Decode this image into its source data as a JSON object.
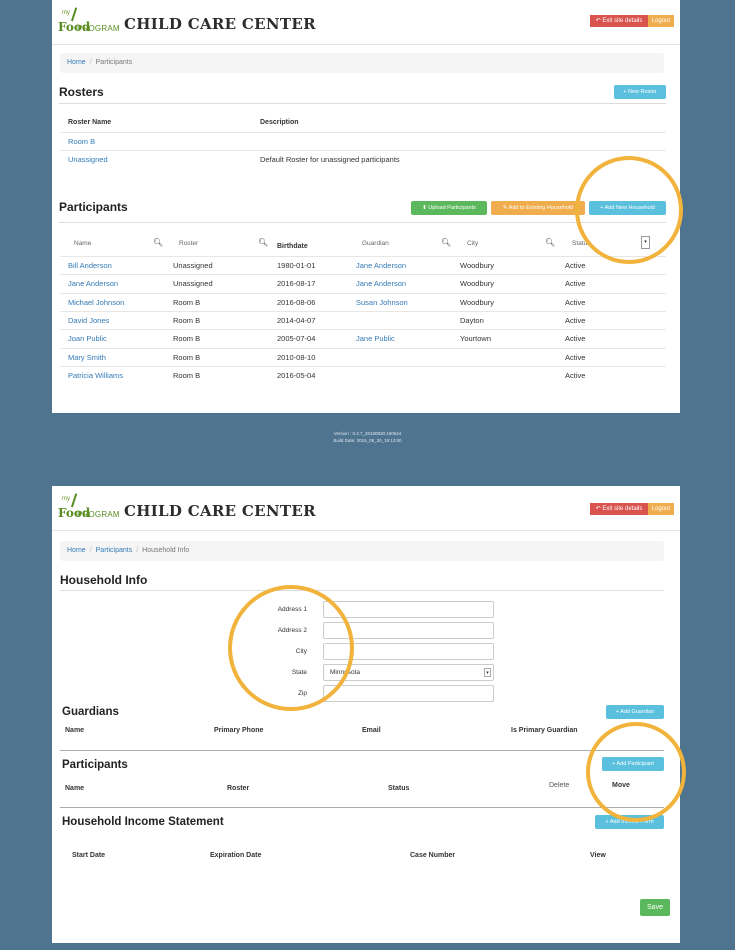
{
  "app": {
    "logo_my": "my",
    "logo_food": "Food",
    "logo_program": "PROGRAM",
    "title": "CHILD CARE CENTER",
    "exit_label": "Exit site details",
    "logout_label": "Logout"
  },
  "screen1": {
    "breadcrumb": [
      "Home",
      "Participants"
    ],
    "rosters": {
      "title": "Rosters",
      "new_button": "+ New Roster",
      "columns": [
        "Roster Name",
        "Description"
      ],
      "rows": [
        {
          "name": "Room B",
          "description": ""
        },
        {
          "name": "Unassigned",
          "description": "Default Roster for unassigned participants"
        }
      ]
    },
    "participants": {
      "title": "Participants",
      "upload_button": "Upload Participants",
      "add_existing_button": "Add to Existing Household",
      "add_new_button": "+ Add New Household",
      "columns": [
        "Name",
        "Roster",
        "Birthdate",
        "Guardian",
        "City",
        "Status"
      ],
      "rows": [
        {
          "name": "Bill Anderson",
          "roster": "Unassigned",
          "birthdate": "1980-01-01",
          "guardian": "Jane Anderson",
          "city": "Woodbury",
          "status": "Active"
        },
        {
          "name": "Jane Anderson",
          "roster": "Unassigned",
          "birthdate": "2016-08-17",
          "guardian": "Jane Anderson",
          "city": "Woodbury",
          "status": "Active"
        },
        {
          "name": "Michael Johnson",
          "roster": "Room B",
          "birthdate": "2016-08-06",
          "guardian": "Susan Johnson",
          "city": "Woodbury",
          "status": "Active"
        },
        {
          "name": "David Jones",
          "roster": "Room B",
          "birthdate": "2014-04-07",
          "guardian": "",
          "city": "Dayton",
          "status": "Active"
        },
        {
          "name": "Joan Public",
          "roster": "Room B",
          "birthdate": "2005-07-04",
          "guardian": "Jane Public",
          "city": "Yourtown",
          "status": "Active"
        },
        {
          "name": "Mary Smith",
          "roster": "Room B",
          "birthdate": "2010-08-10",
          "guardian": "",
          "city": "",
          "status": "Active"
        },
        {
          "name": "Patricia Williams",
          "roster": "Room B",
          "birthdate": "2016-05-04",
          "guardian": "",
          "city": "",
          "status": "Active"
        }
      ]
    },
    "footer_version": "Version : 0.2.7_20160830.160644",
    "footer_build": "Build Date: 2016_08_30_15:13:00"
  },
  "screen2": {
    "breadcrumb": [
      "Home",
      "Participants",
      "Household Info"
    ],
    "household_title": "Household Info",
    "fields": [
      {
        "label": "Address 1",
        "value": ""
      },
      {
        "label": "Address 2",
        "value": ""
      },
      {
        "label": "City",
        "value": ""
      },
      {
        "label": "State",
        "value": "Minnesota"
      },
      {
        "label": "Zip",
        "value": ""
      }
    ],
    "guardians": {
      "title": "Guardians",
      "add_button": "+ Add Guardian",
      "columns": [
        "Name",
        "Primary Phone",
        "Email",
        "Is Primary Guardian"
      ]
    },
    "participants": {
      "title": "Participants",
      "add_button": "+ Add Participant",
      "columns": [
        "Name",
        "Roster",
        "Status",
        "Delete",
        "Move"
      ]
    },
    "income": {
      "title": "Household Income Statement",
      "add_button": "+ Add Income Form",
      "columns": [
        "Start Date",
        "Expiration Date",
        "Case Number",
        "View"
      ]
    },
    "save_button": "Save"
  },
  "colors": {
    "background": "#4f7490",
    "link": "#337ab7",
    "info": "#5bc0de",
    "success": "#5cb85c",
    "warning": "#f0ad4e",
    "danger": "#d9534f",
    "highlight_ring": "#f2b33d"
  }
}
